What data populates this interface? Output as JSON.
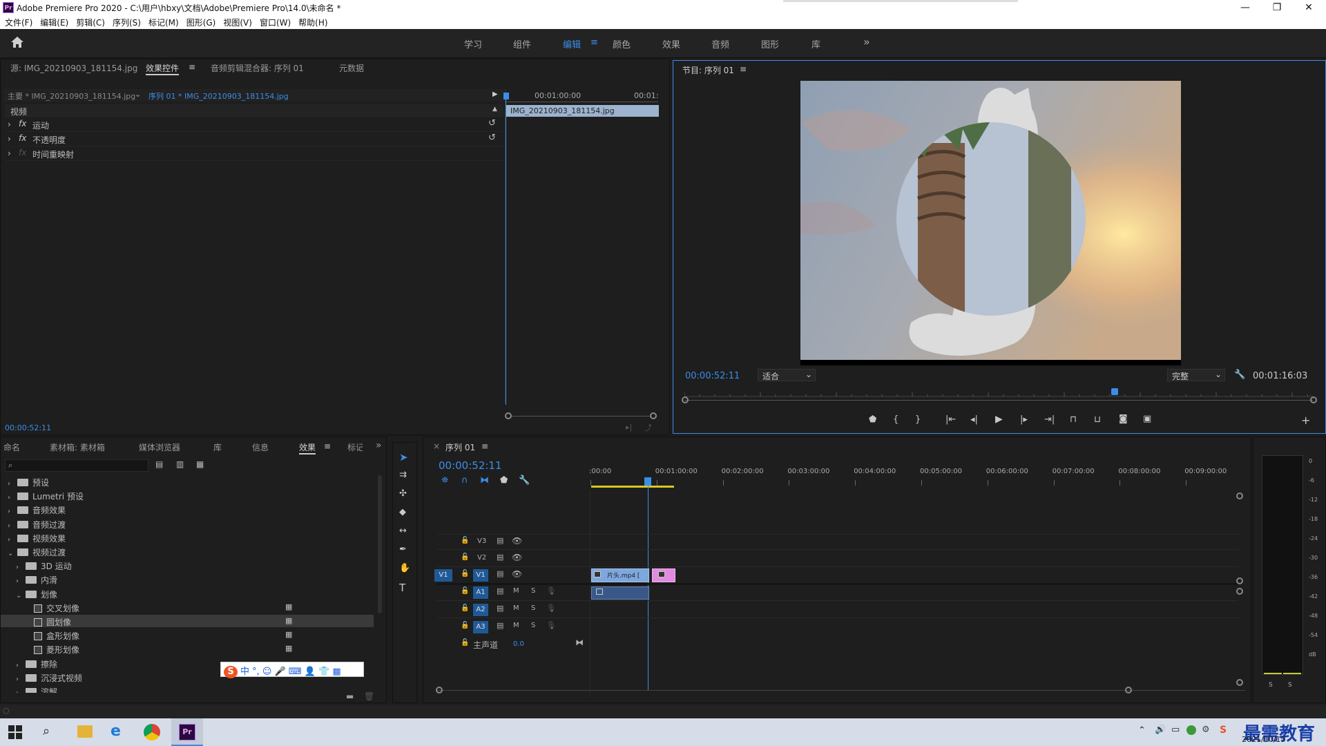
{
  "window": {
    "title": "Adobe Premiere Pro 2020 - C:\\用户\\hbxy\\文档\\Adobe\\Premiere Pro\\14.0\\未命名 *",
    "logo": "Pr",
    "min": "—",
    "max": "❐",
    "close": "✕"
  },
  "menu": [
    "文件(F)",
    "编辑(E)",
    "剪辑(C)",
    "序列(S)",
    "标记(M)",
    "图形(G)",
    "视图(V)",
    "窗口(W)",
    "帮助(H)"
  ],
  "workspaces": {
    "items": [
      "学习",
      "组件",
      "编辑",
      "颜色",
      "效果",
      "音频",
      "图形",
      "库"
    ],
    "active": "编辑",
    "more": "»"
  },
  "effect_controls": {
    "tabs": [
      "源: IMG_20210903_181154.jpg",
      "效果控件",
      "音频剪辑混合器: 序列 01",
      "元数据"
    ],
    "master_label": "主要 * IMG_20210903_181154.jpg",
    "sequence_label": "序列 01 * IMG_20210903_181154.jpg",
    "ruler_times": [
      "00:01:00:00",
      "00:01:"
    ],
    "clip_name": "IMG_20210903_181154.jpg",
    "section": "视频",
    "effects": [
      {
        "label": "运动",
        "fx": "fx"
      },
      {
        "label": "不透明度",
        "fx": "fx"
      },
      {
        "label": "时间重映射",
        "fx": "fx"
      }
    ],
    "timecode": "00:00:52:11"
  },
  "program": {
    "title": "节目: 序列 01",
    "timecode": "00:00:52:11",
    "fit": "适合",
    "quality": "完整",
    "duration": "00:01:16:03",
    "playhead_fraction": 0.685
  },
  "project": {
    "tabs": [
      "命名",
      "素材箱: 素材箱",
      "媒体浏览器",
      "库",
      "信息",
      "效果",
      "标记"
    ],
    "search_placeholder": "",
    "tree": [
      {
        "label": "预设",
        "level": 0,
        "type": "folder",
        "open": false
      },
      {
        "label": "Lumetri 预设",
        "level": 0,
        "type": "folder",
        "open": false
      },
      {
        "label": "音频效果",
        "level": 0,
        "type": "folder",
        "open": false
      },
      {
        "label": "音频过渡",
        "level": 0,
        "type": "folder",
        "open": false
      },
      {
        "label": "视频效果",
        "level": 0,
        "type": "folder",
        "open": false
      },
      {
        "label": "视频过渡",
        "level": 0,
        "type": "folder",
        "open": true
      },
      {
        "label": "3D 运动",
        "level": 1,
        "type": "folder",
        "open": false
      },
      {
        "label": "内滑",
        "level": 1,
        "type": "folder",
        "open": false
      },
      {
        "label": "划像",
        "level": 1,
        "type": "folder",
        "open": true
      },
      {
        "label": "交叉划像",
        "level": 2,
        "type": "fx"
      },
      {
        "label": "圆划像",
        "level": 2,
        "type": "fx",
        "selected": true
      },
      {
        "label": "盒形划像",
        "level": 2,
        "type": "fx"
      },
      {
        "label": "菱形划像",
        "level": 2,
        "type": "fx"
      },
      {
        "label": "擦除",
        "level": 1,
        "type": "folder",
        "open": false
      },
      {
        "label": "沉浸式视频",
        "level": 1,
        "type": "folder",
        "open": false
      },
      {
        "label": "溶解",
        "level": 1,
        "type": "folder",
        "open": false
      }
    ],
    "ime": "中 °, ☺ 🎤 ⌨ 👤 👕 ▦"
  },
  "timeline": {
    "tab": "序列 01",
    "timecode": "00:00:52:11",
    "ruler": [
      ":00:00",
      "00:01:00:00",
      "00:02:00:00",
      "00:03:00:00",
      "00:04:00:00",
      "00:05:00:00",
      "00:06:00:00",
      "00:07:00:00",
      "00:08:00:00",
      "00:09:00:00"
    ],
    "video_tracks": [
      "V3",
      "V2",
      "V1"
    ],
    "audio_tracks": [
      "A1",
      "A2",
      "A3"
    ],
    "source_patch": "V1",
    "master_label": "主声道",
    "master_value": "0.0",
    "clip_v1": "片头.mp4 [",
    "m": "M",
    "s": "S"
  },
  "meter": {
    "labels": [
      "0",
      "-6",
      "-12",
      "-18",
      "-24",
      "-30",
      "-36",
      "-42",
      "-48",
      "-54",
      "dB"
    ],
    "solo": [
      "S",
      "S"
    ]
  },
  "taskbar": {
    "date": "2021/10/15",
    "watermark": "最需教育"
  },
  "colors": {
    "accent": "#3b8ee8",
    "clip_video": "#6f9bd6",
    "clip_pink": "#e08be0",
    "panel_bg": "#1e1e1e"
  }
}
